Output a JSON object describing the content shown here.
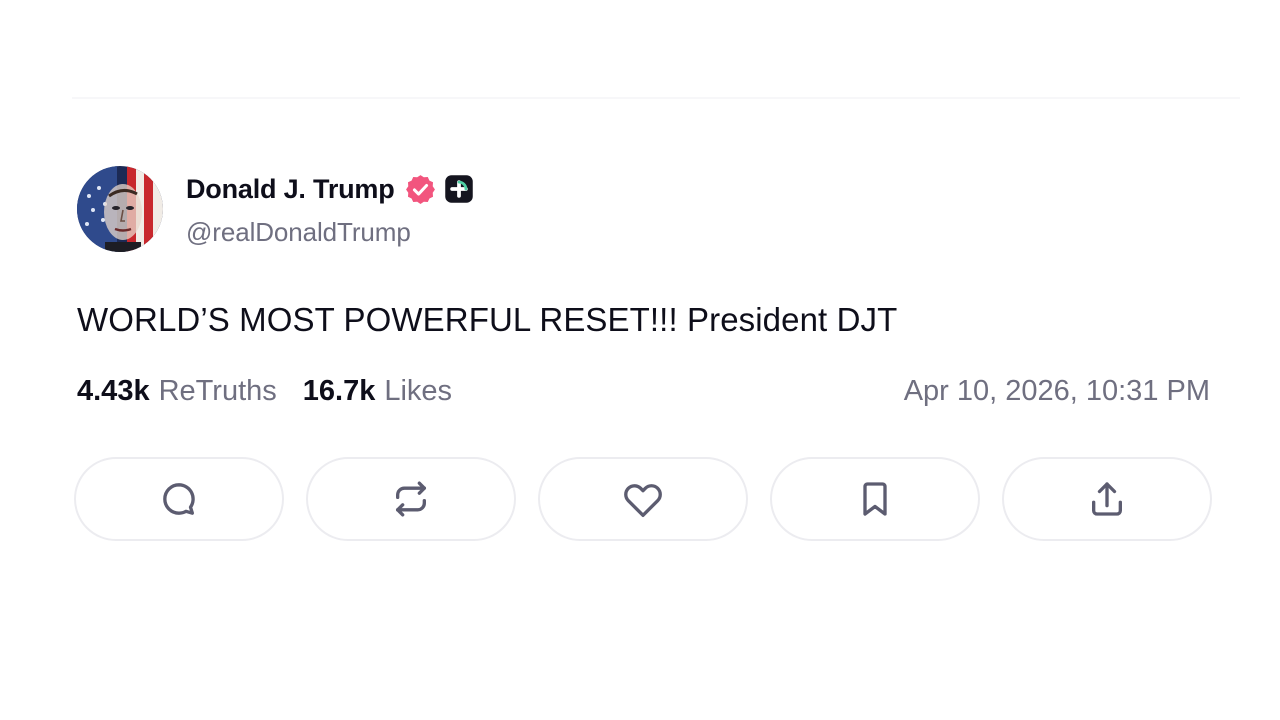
{
  "post": {
    "author": {
      "display_name": "Donald J. Trump",
      "handle": "@realDonaldTrump",
      "verified_badge": "verified-check-icon",
      "extra_badge": "plus-badge-icon"
    },
    "content": "WORLD’S MOST POWERFUL RESET!!! President DJT",
    "stats": {
      "retruths_count": "4.43k",
      "retruths_label": "ReTruths",
      "likes_count": "16.7k",
      "likes_label": "Likes"
    },
    "timestamp": "Apr 10, 2026, 10:31 PM"
  },
  "actions": [
    {
      "name": "reply",
      "icon": "comment-icon"
    },
    {
      "name": "retruth",
      "icon": "repost-icon"
    },
    {
      "name": "like",
      "icon": "heart-icon"
    },
    {
      "name": "bookmark",
      "icon": "bookmark-icon"
    },
    {
      "name": "share",
      "icon": "share-icon"
    }
  ],
  "colors": {
    "text_primary": "#0e0e1a",
    "text_secondary": "#6f6f80",
    "verified_pink": "#f2557e",
    "button_border": "#ececf0",
    "icon_gray": "#5c5c70"
  }
}
